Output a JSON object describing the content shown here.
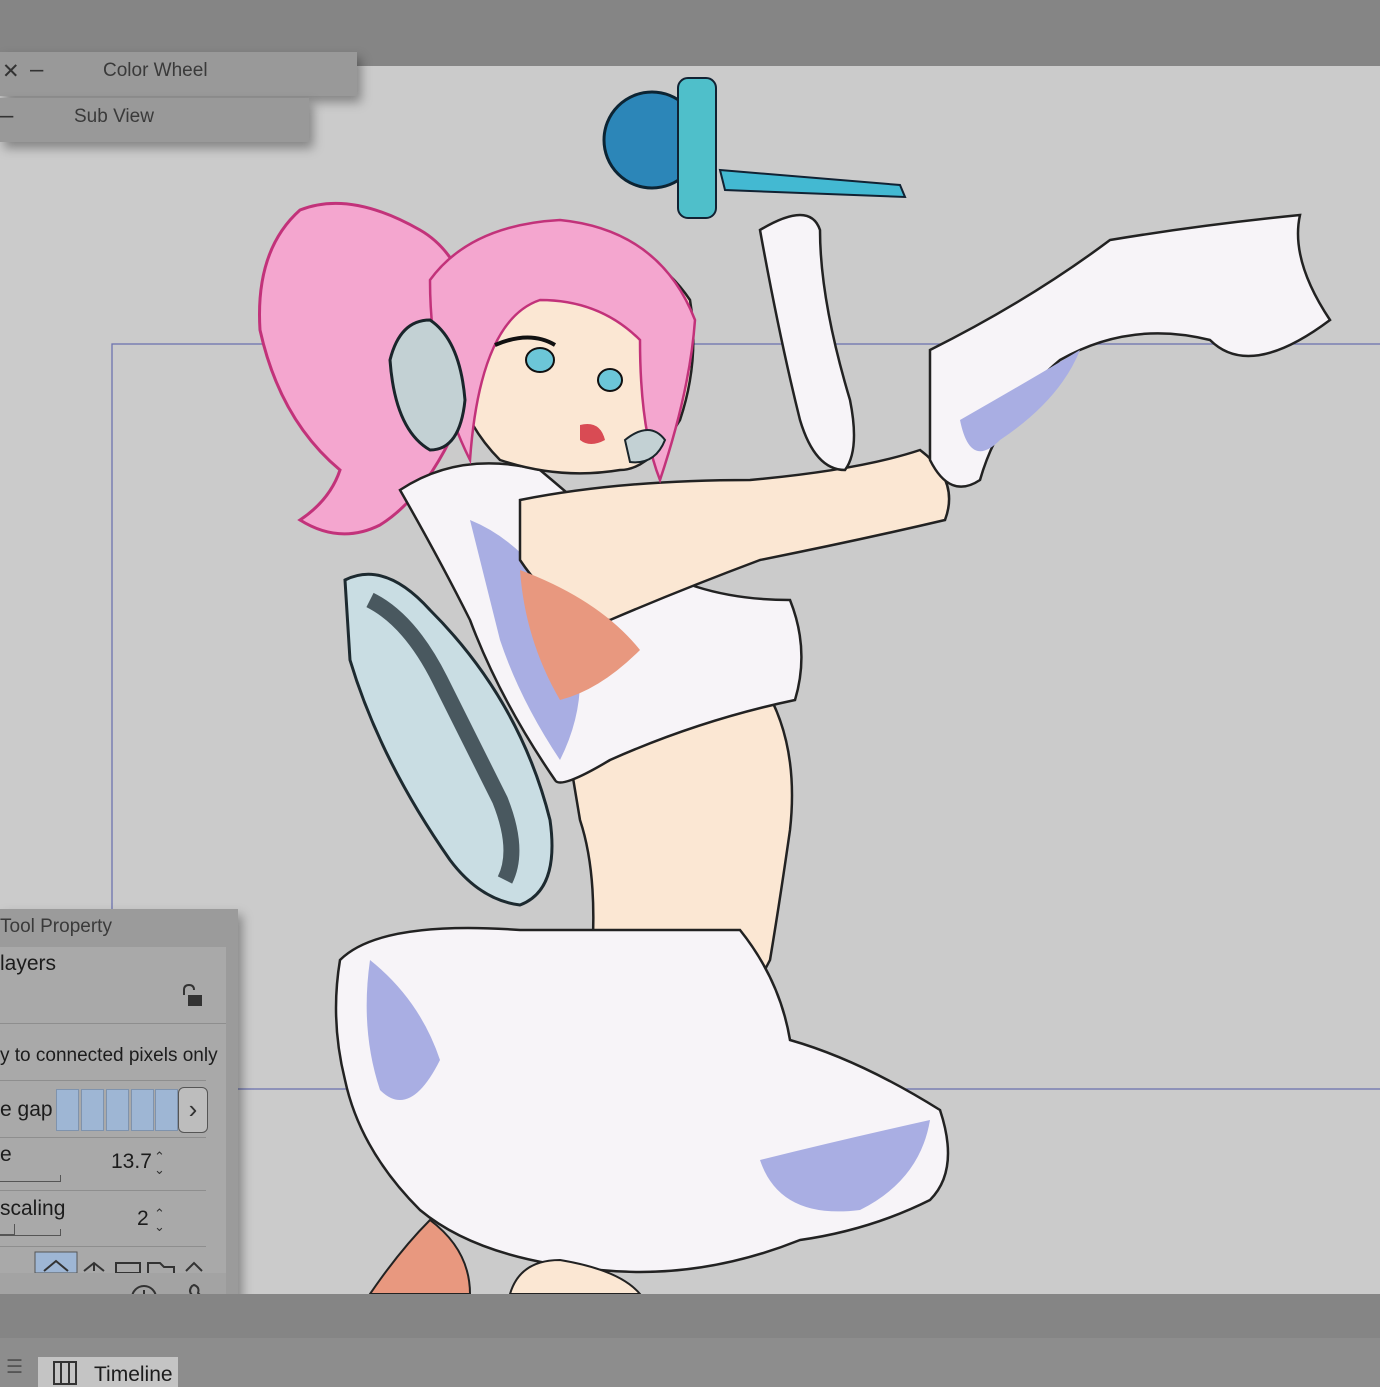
{
  "windows": {
    "color_wheel": {
      "title": "Color Wheel",
      "close_glyph": "✕",
      "minimize_glyph": "–"
    },
    "sub_view": {
      "title": "Sub View",
      "minimize_glyph": "–"
    }
  },
  "tool_property": {
    "title": "Tool Property",
    "layers_label": "layers",
    "connected_label": "y to connected pixels only",
    "gap_label": "e gap",
    "gap_next_glyph": "›",
    "size_label": "e",
    "size_value": "13.7",
    "scaling_label": " scaling",
    "scaling_value": "2",
    "stepper_up": "⌃",
    "stepper_down": "⌄"
  },
  "bottom_bar": {
    "menu_glyph": "☰",
    "timeline_label": "Timeline"
  },
  "colors": {
    "canvas_bg": "#cbcbcb",
    "guide_line": "#6d73b0",
    "hair": "#f4a6cf",
    "skin": "#fbe7d3",
    "outfit": "#f7f4f8",
    "outfit_shadow": "#a9aee3",
    "accent_blue": "#2c86b8",
    "gap_fill": "#9eb6d4"
  },
  "icons": [
    "close-icon",
    "minimize-icon",
    "lock-icon",
    "chevron-right-icon",
    "shape-icon",
    "timer-icon",
    "wrench-icon",
    "hamburger-icon",
    "timeline-icon"
  ]
}
